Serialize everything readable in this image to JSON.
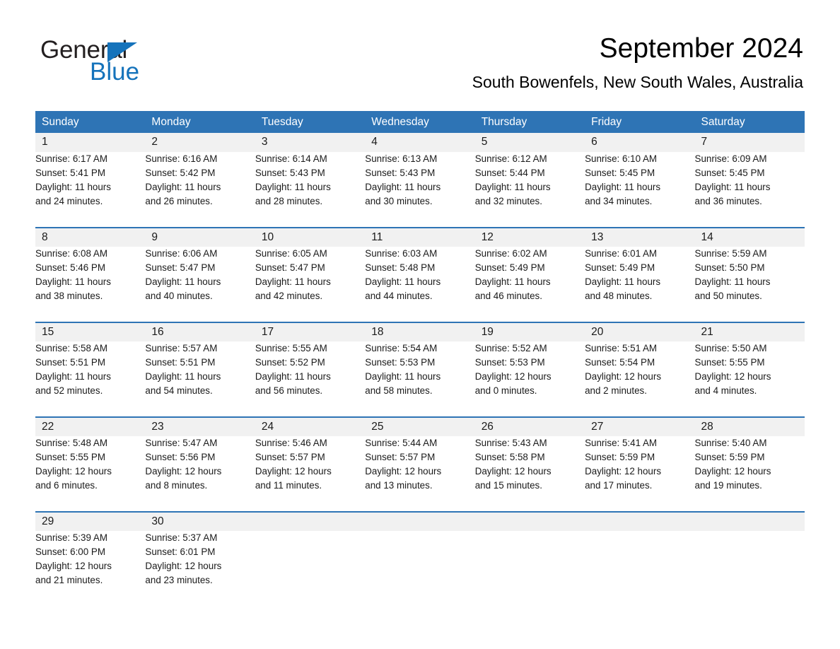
{
  "brand": {
    "name_part1": "General",
    "name_part2": "Blue",
    "accent_color": "#1573bb"
  },
  "header": {
    "title": "September 2024",
    "location": "South Bowenfels, New South Wales, Australia"
  },
  "theme": {
    "header_blue": "#2e74b5",
    "date_band_gray": "#f1f1f1",
    "text_color": "#1a1a1a"
  },
  "weekdays": [
    "Sunday",
    "Monday",
    "Tuesday",
    "Wednesday",
    "Thursday",
    "Friday",
    "Saturday"
  ],
  "weeks": [
    [
      {
        "day": "1",
        "sunrise": "Sunrise: 6:17 AM",
        "sunset": "Sunset: 5:41 PM",
        "daylight_line1": "Daylight: 11 hours",
        "daylight_line2": "and 24 minutes."
      },
      {
        "day": "2",
        "sunrise": "Sunrise: 6:16 AM",
        "sunset": "Sunset: 5:42 PM",
        "daylight_line1": "Daylight: 11 hours",
        "daylight_line2": "and 26 minutes."
      },
      {
        "day": "3",
        "sunrise": "Sunrise: 6:14 AM",
        "sunset": "Sunset: 5:43 PM",
        "daylight_line1": "Daylight: 11 hours",
        "daylight_line2": "and 28 minutes."
      },
      {
        "day": "4",
        "sunrise": "Sunrise: 6:13 AM",
        "sunset": "Sunset: 5:43 PM",
        "daylight_line1": "Daylight: 11 hours",
        "daylight_line2": "and 30 minutes."
      },
      {
        "day": "5",
        "sunrise": "Sunrise: 6:12 AM",
        "sunset": "Sunset: 5:44 PM",
        "daylight_line1": "Daylight: 11 hours",
        "daylight_line2": "and 32 minutes."
      },
      {
        "day": "6",
        "sunrise": "Sunrise: 6:10 AM",
        "sunset": "Sunset: 5:45 PM",
        "daylight_line1": "Daylight: 11 hours",
        "daylight_line2": "and 34 minutes."
      },
      {
        "day": "7",
        "sunrise": "Sunrise: 6:09 AM",
        "sunset": "Sunset: 5:45 PM",
        "daylight_line1": "Daylight: 11 hours",
        "daylight_line2": "and 36 minutes."
      }
    ],
    [
      {
        "day": "8",
        "sunrise": "Sunrise: 6:08 AM",
        "sunset": "Sunset: 5:46 PM",
        "daylight_line1": "Daylight: 11 hours",
        "daylight_line2": "and 38 minutes."
      },
      {
        "day": "9",
        "sunrise": "Sunrise: 6:06 AM",
        "sunset": "Sunset: 5:47 PM",
        "daylight_line1": "Daylight: 11 hours",
        "daylight_line2": "and 40 minutes."
      },
      {
        "day": "10",
        "sunrise": "Sunrise: 6:05 AM",
        "sunset": "Sunset: 5:47 PM",
        "daylight_line1": "Daylight: 11 hours",
        "daylight_line2": "and 42 minutes."
      },
      {
        "day": "11",
        "sunrise": "Sunrise: 6:03 AM",
        "sunset": "Sunset: 5:48 PM",
        "daylight_line1": "Daylight: 11 hours",
        "daylight_line2": "and 44 minutes."
      },
      {
        "day": "12",
        "sunrise": "Sunrise: 6:02 AM",
        "sunset": "Sunset: 5:49 PM",
        "daylight_line1": "Daylight: 11 hours",
        "daylight_line2": "and 46 minutes."
      },
      {
        "day": "13",
        "sunrise": "Sunrise: 6:01 AM",
        "sunset": "Sunset: 5:49 PM",
        "daylight_line1": "Daylight: 11 hours",
        "daylight_line2": "and 48 minutes."
      },
      {
        "day": "14",
        "sunrise": "Sunrise: 5:59 AM",
        "sunset": "Sunset: 5:50 PM",
        "daylight_line1": "Daylight: 11 hours",
        "daylight_line2": "and 50 minutes."
      }
    ],
    [
      {
        "day": "15",
        "sunrise": "Sunrise: 5:58 AM",
        "sunset": "Sunset: 5:51 PM",
        "daylight_line1": "Daylight: 11 hours",
        "daylight_line2": "and 52 minutes."
      },
      {
        "day": "16",
        "sunrise": "Sunrise: 5:57 AM",
        "sunset": "Sunset: 5:51 PM",
        "daylight_line1": "Daylight: 11 hours",
        "daylight_line2": "and 54 minutes."
      },
      {
        "day": "17",
        "sunrise": "Sunrise: 5:55 AM",
        "sunset": "Sunset: 5:52 PM",
        "daylight_line1": "Daylight: 11 hours",
        "daylight_line2": "and 56 minutes."
      },
      {
        "day": "18",
        "sunrise": "Sunrise: 5:54 AM",
        "sunset": "Sunset: 5:53 PM",
        "daylight_line1": "Daylight: 11 hours",
        "daylight_line2": "and 58 minutes."
      },
      {
        "day": "19",
        "sunrise": "Sunrise: 5:52 AM",
        "sunset": "Sunset: 5:53 PM",
        "daylight_line1": "Daylight: 12 hours",
        "daylight_line2": "and 0 minutes."
      },
      {
        "day": "20",
        "sunrise": "Sunrise: 5:51 AM",
        "sunset": "Sunset: 5:54 PM",
        "daylight_line1": "Daylight: 12 hours",
        "daylight_line2": "and 2 minutes."
      },
      {
        "day": "21",
        "sunrise": "Sunrise: 5:50 AM",
        "sunset": "Sunset: 5:55 PM",
        "daylight_line1": "Daylight: 12 hours",
        "daylight_line2": "and 4 minutes."
      }
    ],
    [
      {
        "day": "22",
        "sunrise": "Sunrise: 5:48 AM",
        "sunset": "Sunset: 5:55 PM",
        "daylight_line1": "Daylight: 12 hours",
        "daylight_line2": "and 6 minutes."
      },
      {
        "day": "23",
        "sunrise": "Sunrise: 5:47 AM",
        "sunset": "Sunset: 5:56 PM",
        "daylight_line1": "Daylight: 12 hours",
        "daylight_line2": "and 8 minutes."
      },
      {
        "day": "24",
        "sunrise": "Sunrise: 5:46 AM",
        "sunset": "Sunset: 5:57 PM",
        "daylight_line1": "Daylight: 12 hours",
        "daylight_line2": "and 11 minutes."
      },
      {
        "day": "25",
        "sunrise": "Sunrise: 5:44 AM",
        "sunset": "Sunset: 5:57 PM",
        "daylight_line1": "Daylight: 12 hours",
        "daylight_line2": "and 13 minutes."
      },
      {
        "day": "26",
        "sunrise": "Sunrise: 5:43 AM",
        "sunset": "Sunset: 5:58 PM",
        "daylight_line1": "Daylight: 12 hours",
        "daylight_line2": "and 15 minutes."
      },
      {
        "day": "27",
        "sunrise": "Sunrise: 5:41 AM",
        "sunset": "Sunset: 5:59 PM",
        "daylight_line1": "Daylight: 12 hours",
        "daylight_line2": "and 17 minutes."
      },
      {
        "day": "28",
        "sunrise": "Sunrise: 5:40 AM",
        "sunset": "Sunset: 5:59 PM",
        "daylight_line1": "Daylight: 12 hours",
        "daylight_line2": "and 19 minutes."
      }
    ],
    [
      {
        "day": "29",
        "sunrise": "Sunrise: 5:39 AM",
        "sunset": "Sunset: 6:00 PM",
        "daylight_line1": "Daylight: 12 hours",
        "daylight_line2": "and 21 minutes."
      },
      {
        "day": "30",
        "sunrise": "Sunrise: 5:37 AM",
        "sunset": "Sunset: 6:01 PM",
        "daylight_line1": "Daylight: 12 hours",
        "daylight_line2": "and 23 minutes."
      },
      {
        "day": "",
        "sunrise": "",
        "sunset": "",
        "daylight_line1": "",
        "daylight_line2": ""
      },
      {
        "day": "",
        "sunrise": "",
        "sunset": "",
        "daylight_line1": "",
        "daylight_line2": ""
      },
      {
        "day": "",
        "sunrise": "",
        "sunset": "",
        "daylight_line1": "",
        "daylight_line2": ""
      },
      {
        "day": "",
        "sunrise": "",
        "sunset": "",
        "daylight_line1": "",
        "daylight_line2": ""
      },
      {
        "day": "",
        "sunrise": "",
        "sunset": "",
        "daylight_line1": "",
        "daylight_line2": ""
      }
    ]
  ]
}
